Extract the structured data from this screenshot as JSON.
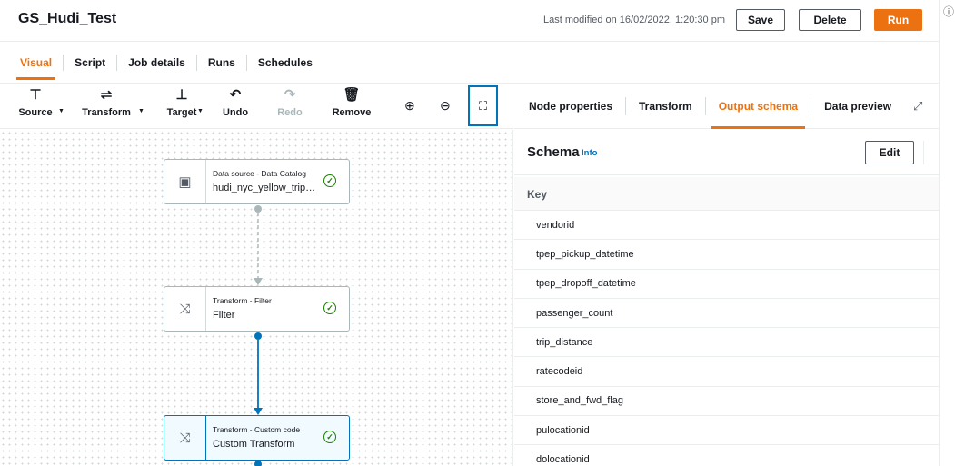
{
  "header": {
    "job_title": "GS_Hudi_Test",
    "last_modified": "Last modified on 16/02/2022, 1:20:30 pm",
    "save_label": "Save",
    "delete_label": "Delete",
    "run_label": "Run",
    "accent_color": "#ec7211"
  },
  "tabs": [
    {
      "label": "Visual",
      "active": true
    },
    {
      "label": "Script"
    },
    {
      "label": "Job details"
    },
    {
      "label": "Runs"
    },
    {
      "label": "Schedules"
    }
  ],
  "toolbar": {
    "source": {
      "label": "Source",
      "icon": "source-icon"
    },
    "transform": {
      "label": "Transform",
      "icon": "transform-icon"
    },
    "target": {
      "label": "Target",
      "icon": "target-icon"
    },
    "undo": {
      "label": "Undo",
      "icon": "undo-icon"
    },
    "redo": {
      "label": "Redo",
      "icon": "redo-icon",
      "disabled": true
    },
    "remove": {
      "label": "Remove",
      "icon": "trash-icon"
    }
  },
  "nodes": [
    {
      "type": "Data source - Data Catalog",
      "name": "hudi_nyc_yellow_trip…",
      "icon": "data-catalog-icon",
      "status": "success"
    },
    {
      "type": "Transform - Filter",
      "name": "Filter",
      "icon": "shuffle-icon",
      "status": "success"
    },
    {
      "type": "Transform - Custom code",
      "name": "Custom Transform",
      "icon": "custom-code-icon",
      "status": "success",
      "selected": true
    }
  ],
  "panel": {
    "tabs": [
      {
        "label": "Node properties"
      },
      {
        "label": "Transform"
      },
      {
        "label": "Output schema",
        "active": true
      },
      {
        "label": "Data preview"
      }
    ],
    "schema_title": "Schema",
    "info_label": "Info",
    "edit_label": "Edit",
    "key_header": "Key",
    "keys": [
      "vendorid",
      "tpep_pickup_datetime",
      "tpep_dropoff_datetime",
      "passenger_count",
      "trip_distance",
      "ratecodeid",
      "store_and_fwd_flag",
      "pulocationid",
      "dolocationid"
    ]
  }
}
